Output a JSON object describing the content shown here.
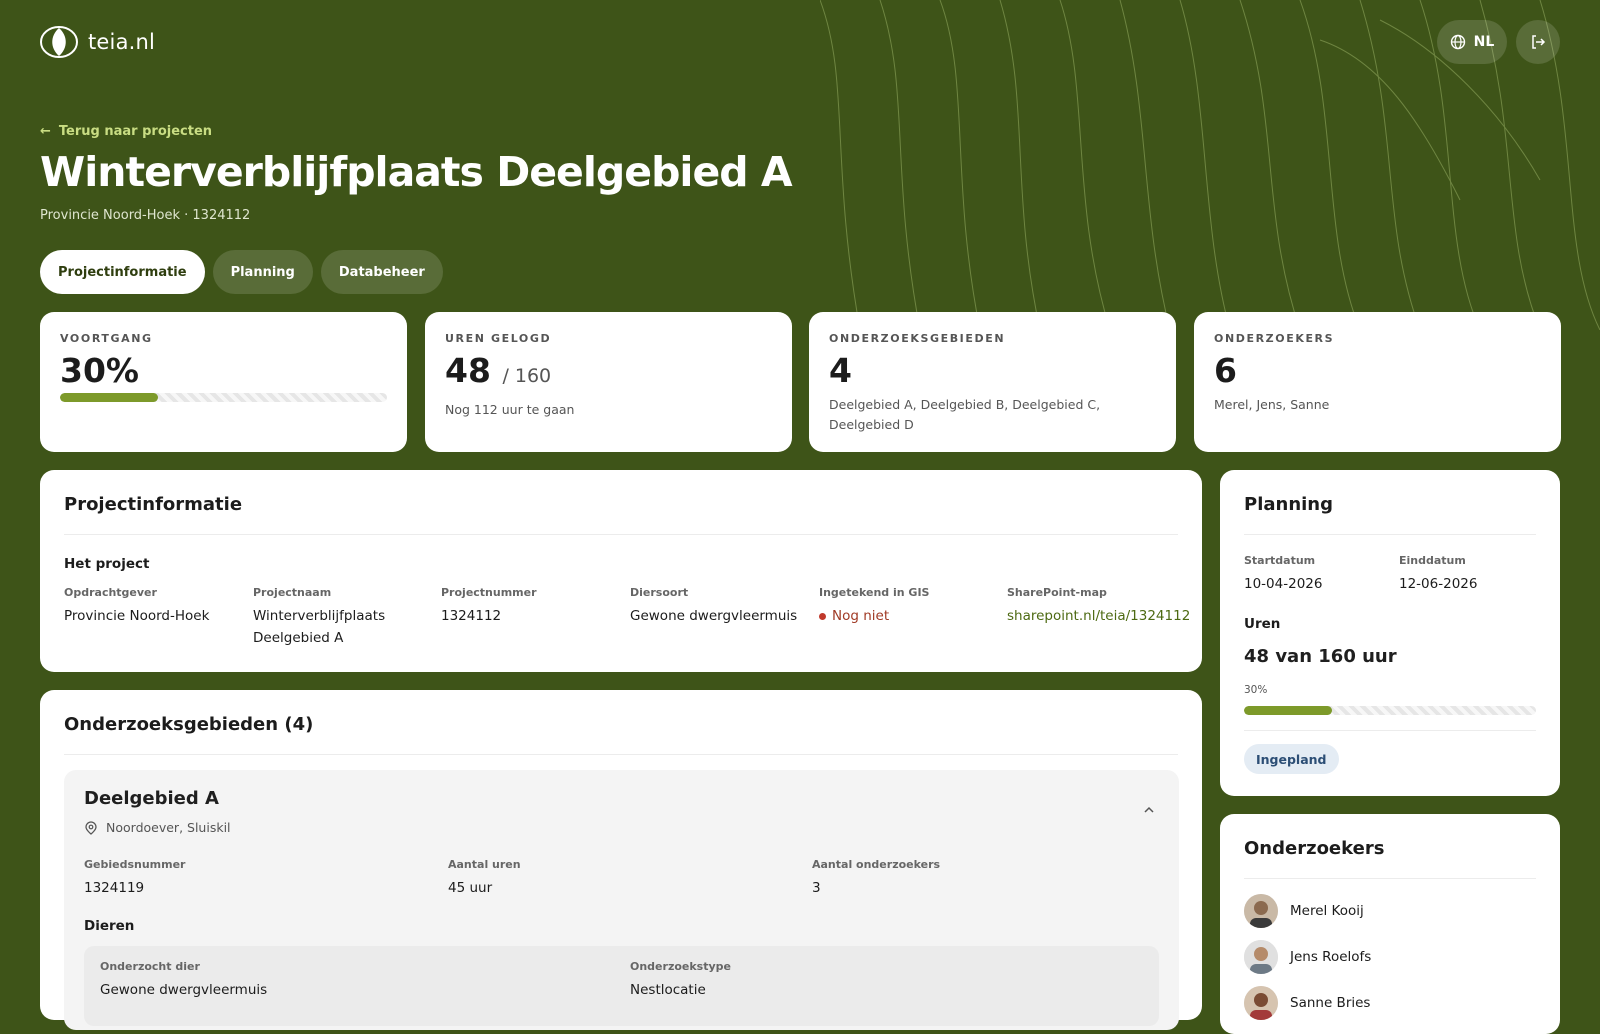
{
  "header": {
    "logo_text": "teia.nl",
    "lang_label": "NL"
  },
  "nav": {
    "back_label": "Terug naar projecten"
  },
  "project": {
    "title": "Winterverblijfplaats Deelgebied A",
    "subtitle": "Provincie Noord-Hoek · 1324112"
  },
  "tabs": [
    {
      "label": "Projectinformatie",
      "active": true
    },
    {
      "label": "Planning",
      "active": false
    },
    {
      "label": "Databeheer",
      "active": false
    }
  ],
  "stats": {
    "progress": {
      "label": "VOORTGANG",
      "value": "30%",
      "fraction": 0.3
    },
    "hours": {
      "label": "UREN GELOGD",
      "value": "48",
      "total": "/ 160",
      "sub": "Nog 112 uur te gaan"
    },
    "areas": {
      "label": "ONDERZOEKSGEBIEDEN",
      "value": "4",
      "sub": "Deelgebied A, Deelgebied B, Deelgebied C, Deelgebied D"
    },
    "researchers": {
      "label": "ONDERZOEKERS",
      "value": "6",
      "sub": "Merel, Jens, Sanne"
    }
  },
  "info": {
    "title": "Projectinformatie",
    "section": "Het project",
    "fields": [
      {
        "label": "Opdrachtgever",
        "value": "Provincie Noord-Hoek"
      },
      {
        "label": "Projectnaam",
        "value": "Winterverblijfplaats Deelgebied A"
      },
      {
        "label": "Projectnummer",
        "value": "1324112"
      },
      {
        "label": "Diersoort",
        "value": "Gewone dwergvleermuis"
      },
      {
        "label": "Ingetekend in GIS",
        "value": "Nog niet"
      },
      {
        "label": "SharePoint-map",
        "value": "sharepoint.nl/teia/1324112"
      }
    ]
  },
  "areas": {
    "title": "Onderzoeksgebieden (4)",
    "first": {
      "name": "Deelgebied A",
      "location": "Noordoever, Sluiskil",
      "fields": [
        {
          "label": "Gebiedsnummer",
          "value": "1324119"
        },
        {
          "label": "Aantal uren",
          "value": "45 uur"
        },
        {
          "label": "Aantal onderzoekers",
          "value": "3"
        }
      ],
      "animals_label": "Dieren",
      "animal": [
        {
          "label": "Onderzocht dier",
          "value": "Gewone dwergvleermuis"
        },
        {
          "label": "Onderzoekstype",
          "value": "Nestlocatie"
        }
      ]
    }
  },
  "planning": {
    "title": "Planning",
    "start_label": "Startdatum",
    "start_value": "10-04-2026",
    "end_label": "Einddatum",
    "end_value": "12-06-2026",
    "hours_label": "Uren",
    "hours_value": "48 van 160 uur",
    "percent": "30%",
    "fraction": 0.3,
    "status": "Ingepland"
  },
  "researchers": {
    "title": "Onderzoekers",
    "people": [
      {
        "name": "Merel Kooij"
      },
      {
        "name": "Jens Roelofs"
      },
      {
        "name": "Sanne Bries"
      }
    ]
  },
  "colors": {
    "background": "#3e5418",
    "accent": "#7d9a2a",
    "link": "#c9dd83",
    "badge_bg": "#e4ecf4",
    "warning": "#c0392b"
  }
}
